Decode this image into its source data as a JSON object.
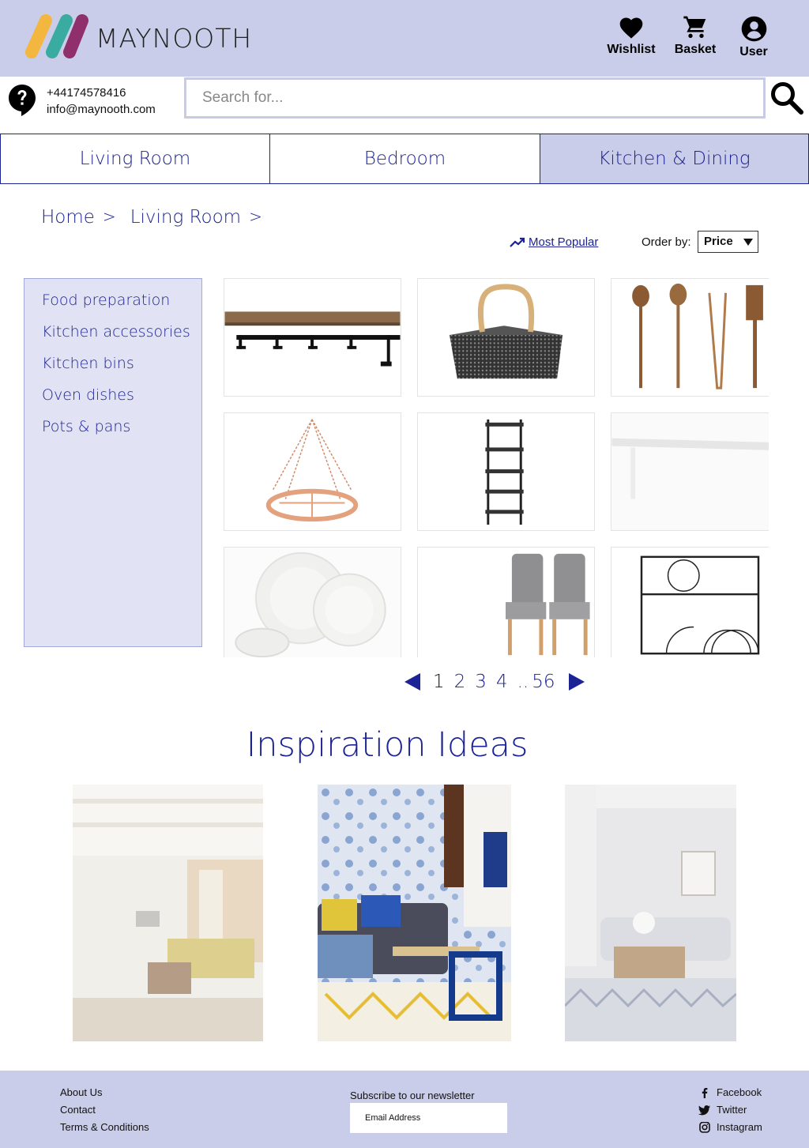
{
  "header": {
    "brand": "MAYNOOTH",
    "wishlist_label": "Wishlist",
    "basket_label": "Basket",
    "user_label": "User",
    "colors": {
      "background": "#cacde9",
      "logo": [
        "#f3b63f",
        "#3aaba0",
        "#8f2f6c"
      ]
    }
  },
  "contact": {
    "phone": "+44174578416",
    "email": "info@maynooth.com"
  },
  "search": {
    "placeholder": "Search for...",
    "value": ""
  },
  "categories": [
    {
      "label": "Living Room",
      "active": false
    },
    {
      "label": "Bedroom",
      "active": false
    },
    {
      "label": "Kitchen & Dining",
      "active": true
    }
  ],
  "breadcrumb": [
    {
      "label": "Home",
      "separator": ">"
    },
    {
      "label": "Living Room",
      "separator": ">"
    }
  ],
  "sort": {
    "most_popular": "Most Popular",
    "order_label": "Order by:",
    "order_value": "Price"
  },
  "sidebar": {
    "items": [
      "Food preparation",
      "Kitchen accessories",
      "Kitchen bins",
      "Oven dishes",
      "Pots & pans"
    ]
  },
  "products": [
    {
      "icon": "wall-shelf-with-hooks"
    },
    {
      "icon": "wire-basket"
    },
    {
      "icon": "wooden-utensils"
    },
    {
      "icon": "hanging-pot-rack"
    },
    {
      "icon": "shelving-tower"
    },
    {
      "icon": "white-bench"
    },
    {
      "icon": "white-plates"
    },
    {
      "icon": "grey-dining-chairs"
    },
    {
      "icon": "wire-dish-rack"
    }
  ],
  "pagination": {
    "current": "1",
    "pages": [
      "2",
      "3",
      "4"
    ],
    "ellipsis": "..",
    "last": "56"
  },
  "inspiration": {
    "title": "Inspiration Ideas",
    "images": [
      {
        "icon": "bright-living-room"
      },
      {
        "icon": "blue-floral-living-room"
      },
      {
        "icon": "grey-lounge-room"
      }
    ]
  },
  "footer": {
    "links": [
      "About Us",
      "Contact",
      "Terms & Conditions"
    ],
    "newsletter_label": "Subscribe to our newsletter",
    "email_placeholder": "Email Address",
    "social": [
      {
        "label": "Facebook",
        "icon": "facebook-icon"
      },
      {
        "label": "Twitter",
        "icon": "twitter-icon"
      },
      {
        "label": "Instagram",
        "icon": "instagram-icon"
      }
    ]
  }
}
